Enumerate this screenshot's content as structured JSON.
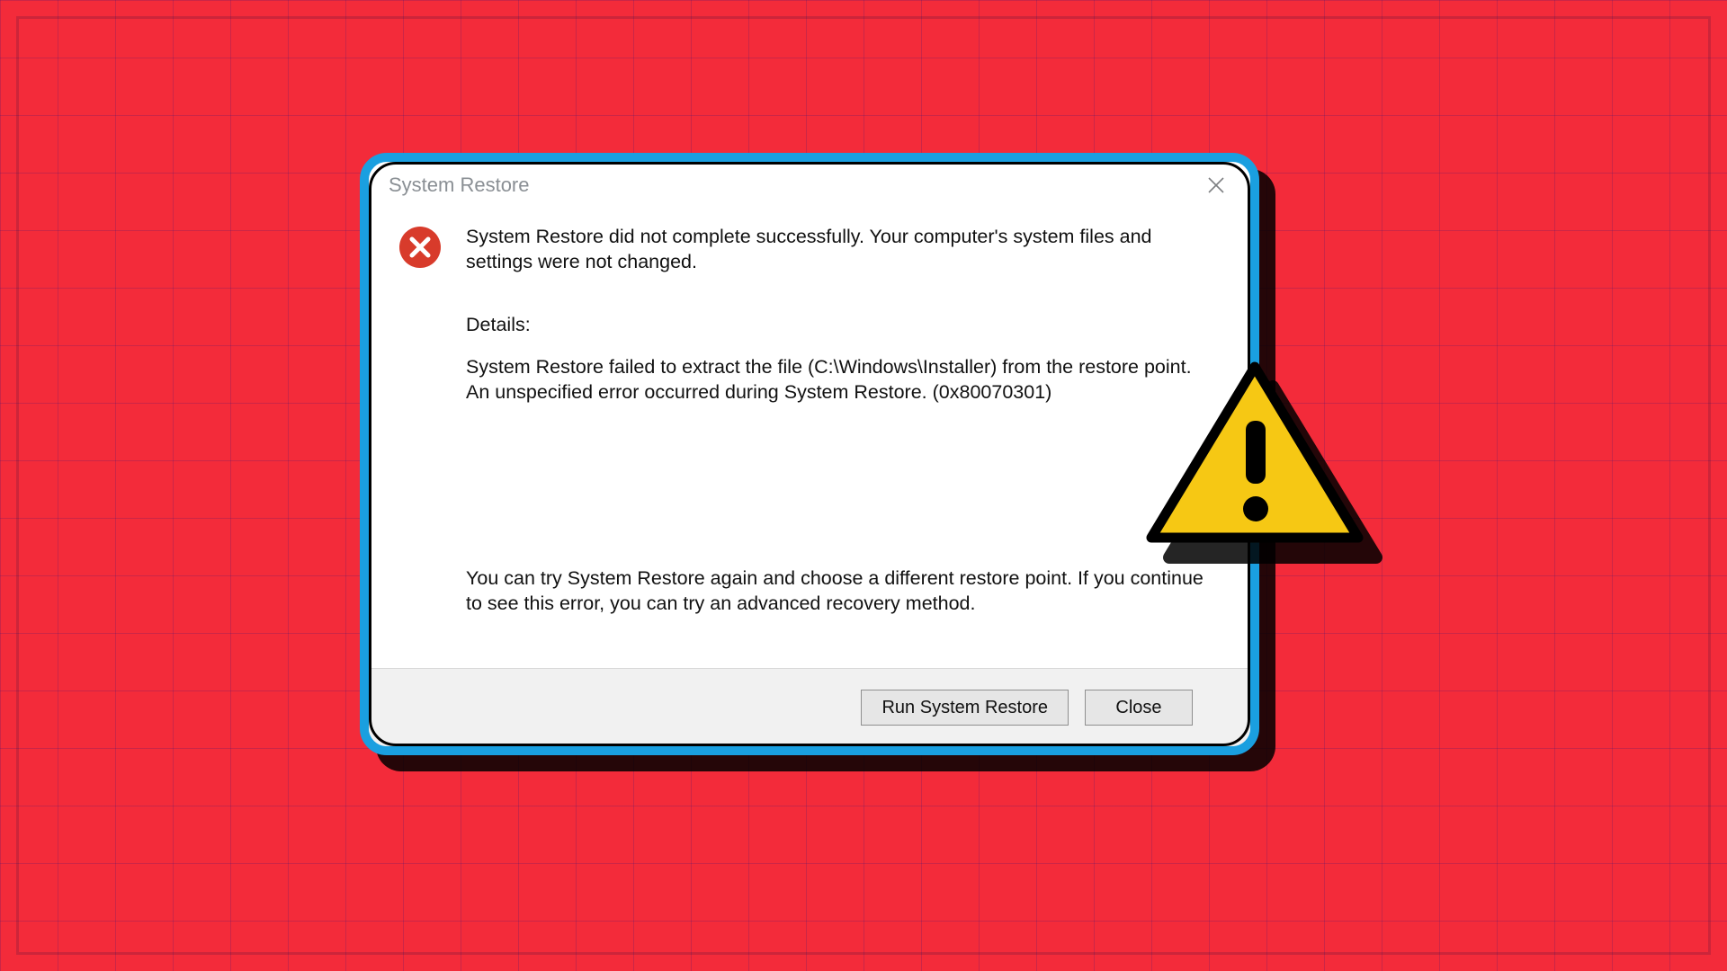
{
  "dialog": {
    "title": "System Restore",
    "error_icon": "error-circle-x",
    "message": "System Restore did not complete successfully. Your computer's system files and settings were not changed.",
    "details_label": "Details:",
    "details_line1": "System Restore failed to extract the file (C:\\Windows\\Installer) from the restore point.",
    "details_line2": "An unspecified error occurred during System Restore. (0x80070301)",
    "suggestion": "You can try System Restore again and choose a different restore point. If you continue to see this error, you can try an advanced recovery method.",
    "buttons": {
      "run": "Run System Restore",
      "close": "Close"
    }
  },
  "overlay": {
    "icon": "warning-triangle"
  },
  "colors": {
    "background": "#f32b3a",
    "dialog_border": "#1a9fe0",
    "error_icon": "#d83b2b",
    "warning_fill": "#f6c814"
  }
}
